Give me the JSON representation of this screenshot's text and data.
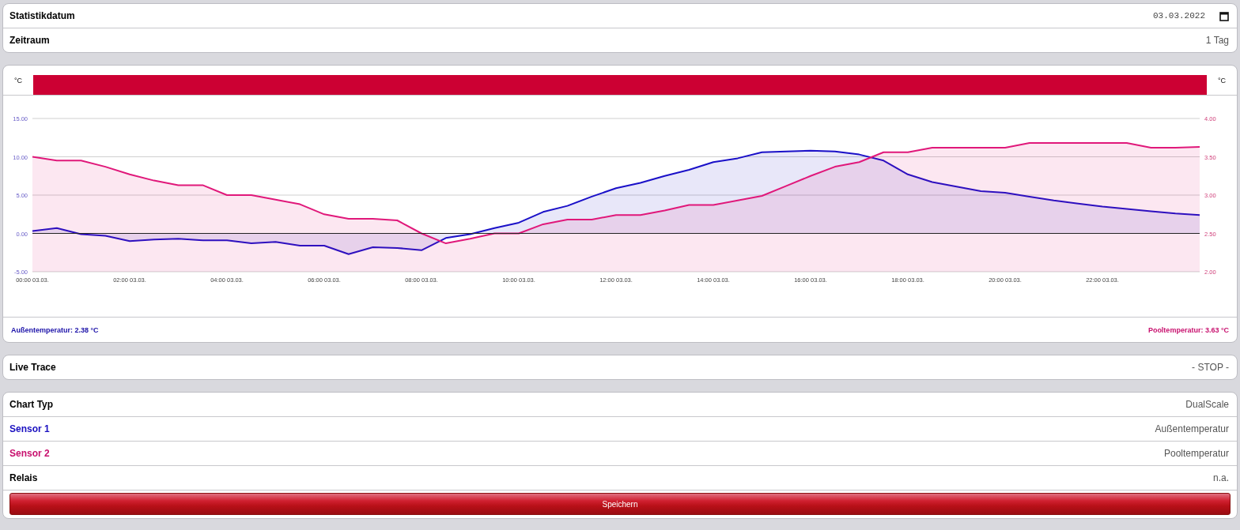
{
  "date_card": {
    "rows": [
      {
        "kind": "date",
        "label": "Statistikdatum",
        "value": "03.03.2022"
      },
      {
        "kind": "text",
        "label": "Zeitraum",
        "value": "1 Tag"
      }
    ]
  },
  "chart_card": {
    "chart_data": {
      "type": "area",
      "ylabel": "°C",
      "y2label": "°C",
      "ylim": [
        -5,
        15
      ],
      "y2lim": [
        2,
        4
      ],
      "categories": [
        "00:00 03.03.",
        null,
        null,
        null,
        "02:00 03.03.",
        null,
        null,
        null,
        "04:00 03.03.",
        null,
        null,
        null,
        "06:00 03.03.",
        null,
        null,
        null,
        "08:00 03.03.",
        null,
        null,
        null,
        "10:00 03.03.",
        null,
        null,
        null,
        "12:00 03.03.",
        null,
        null,
        null,
        "14:00 03.03.",
        null,
        null,
        null,
        "16:00 03.03.",
        null,
        null,
        null,
        "18:00 03.03.",
        null,
        null,
        null,
        "20:00 03.03.",
        null,
        null,
        null,
        "22:00 03.03.",
        null,
        null,
        null,
        null
      ],
      "yticks": [
        {
          "value": 15,
          "label": "15.00"
        },
        {
          "value": 10,
          "label": "10.00"
        },
        {
          "value": 5,
          "label": "5.00"
        },
        {
          "value": 0,
          "label": "0.00"
        },
        {
          "value": -5,
          "label": "-5.00"
        }
      ],
      "y2ticks": [
        {
          "value": 4,
          "label": "4.00"
        },
        {
          "value": 3.5,
          "label": "3.50"
        },
        {
          "value": 3,
          "label": "3.00"
        },
        {
          "value": 2.5,
          "label": "2.50"
        },
        {
          "value": 2,
          "label": "2.00"
        }
      ],
      "series": [
        {
          "name": "Außentemperatur",
          "color": "#1a10c8",
          "values": [
            0.3,
            0.7,
            -0.1,
            -0.3,
            -1.0,
            -0.8,
            -0.7,
            -0.9,
            -0.9,
            -1.3,
            -1.1,
            -1.6,
            -1.6,
            -2.7,
            -1.8,
            -1.9,
            -2.2,
            -0.6,
            -0.1,
            0.7,
            1.4,
            2.8,
            3.6,
            4.8,
            5.9,
            6.6,
            7.5,
            8.3,
            9.3,
            9.8,
            10.6,
            10.7,
            10.8,
            10.7,
            10.3,
            9.5,
            7.7,
            6.7,
            6.1,
            5.5,
            5.3,
            4.8,
            4.3,
            3.9,
            3.5,
            3.2,
            2.9,
            2.6,
            2.4
          ]
        },
        {
          "name": "Pooltemperatur",
          "color": "#e0187a",
          "axis": "y2",
          "values": [
            3.5,
            3.45,
            3.45,
            3.37,
            3.27,
            3.19,
            3.13,
            3.13,
            3.0,
            3.0,
            2.94,
            2.88,
            2.75,
            2.69,
            2.69,
            2.67,
            2.5,
            2.37,
            2.43,
            2.5,
            2.5,
            2.62,
            2.68,
            2.68,
            2.74,
            2.74,
            2.8,
            2.87,
            2.87,
            2.93,
            2.99,
            3.12,
            3.25,
            3.37,
            3.43,
            3.56,
            3.56,
            3.62,
            3.62,
            3.62,
            3.62,
            3.68,
            3.68,
            3.68,
            3.68,
            3.68,
            3.62,
            3.62,
            3.63
          ]
        }
      ]
    },
    "legend": [
      {
        "reading": ": 2.38 °C",
        "color": "#1a10a8"
      },
      {
        "reading": ": 3.63 °C",
        "color": "#c8106e"
      }
    ]
  },
  "live_trace": {
    "label": "Live Trace",
    "value": "- STOP -"
  },
  "settings": {
    "rows": [
      {
        "label": "Chart Typ",
        "value": "DualScale",
        "color": "#000000"
      },
      {
        "label": "Sensor 1",
        "value": "Außentemperatur",
        "color": "#1a10c0"
      },
      {
        "label": "Sensor 2",
        "value": "Pooltemperatur",
        "color": "#c8106e"
      },
      {
        "label": "Relais",
        "value": "n.a.",
        "color": "#000000"
      }
    ],
    "save_button": "Speichern"
  }
}
